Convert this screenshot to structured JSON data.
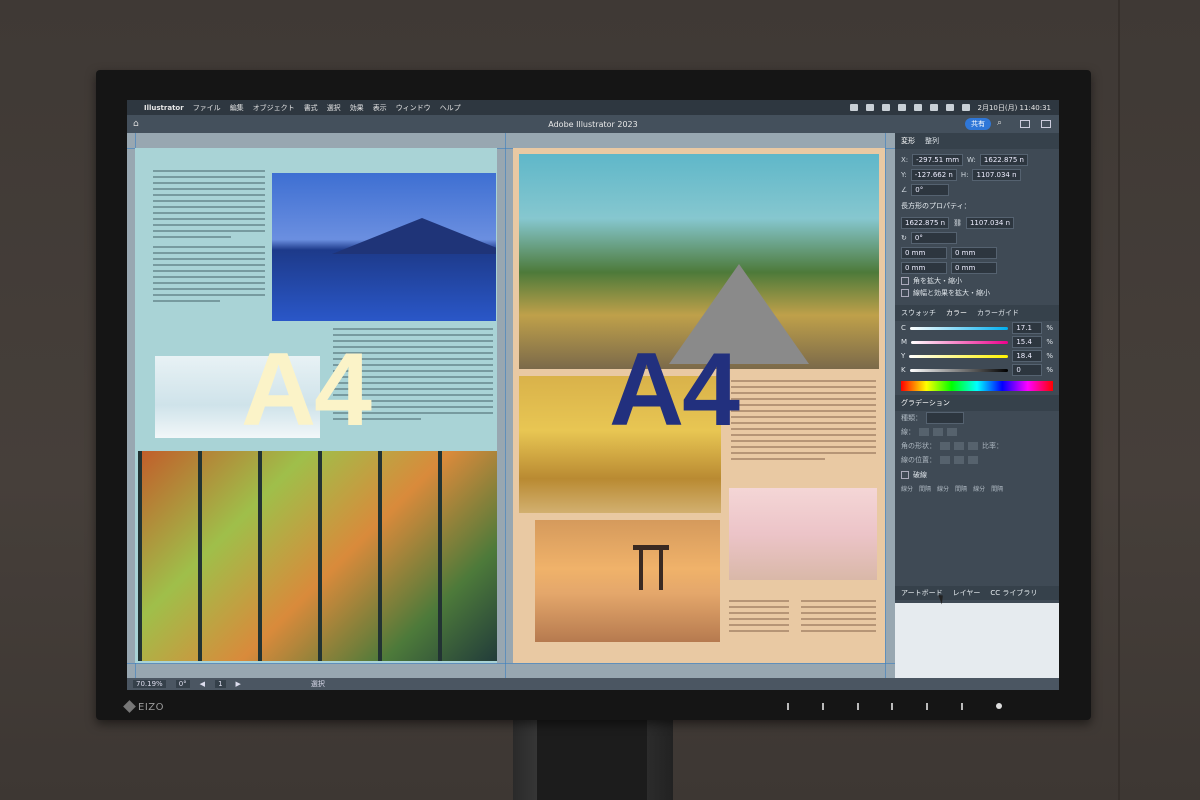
{
  "menubar": {
    "items": [
      "Illustrator",
      "ファイル",
      "編集",
      "オブジェクト",
      "書式",
      "選択",
      "効果",
      "表示",
      "ウィンドウ",
      "ヘルプ"
    ],
    "clock": "2月10日(月) 11:40:31"
  },
  "titlebar": {
    "title": "Adobe Illustrator 2023",
    "share_label": "共有"
  },
  "canvas": {
    "left_label": "A4",
    "right_label": "A4"
  },
  "panel": {
    "tabs": [
      "変形",
      "整列"
    ],
    "x_label": "X:",
    "x_value": "-297.51 mm",
    "y_label": "Y:",
    "y_value": "-127.662 n",
    "w_label": "W:",
    "w_value": "1622.875 n",
    "h_label": "H:",
    "h_value": "1107.034 n",
    "angle_value": "0°",
    "rect_props_title": "長方形のプロパティ：",
    "rect_w": "1622.875 n",
    "rect_h": "1107.034 n",
    "rect_angle": "0°",
    "corner_1": "0 mm",
    "corner_2": "0 mm",
    "corner_3": "0 mm",
    "corner_4": "0 mm",
    "check_1": "角を拡大・縮小",
    "check_2": "線幅と効果を拡大・縮小",
    "color_tabs": [
      "スウォッチ",
      "カラー",
      "カラーガイド"
    ],
    "c_label": "C",
    "c_value": "17.1",
    "m_label": "M",
    "m_value": "15.4",
    "y2_label": "Y",
    "y2_value": "18.4",
    "k_label": "K",
    "k_value": "0",
    "percent": "%",
    "gradient_title": "グラデーション",
    "grad_rows": [
      "種類：",
      "線：",
      "角の形状：",
      "線の位置："
    ],
    "ratio_label": "比率：",
    "dashed_label": "破線",
    "dash_labels": [
      "線分",
      "間隔",
      "線分",
      "間隔",
      "線分",
      "間隔"
    ],
    "bottom_tabs": [
      "アートボード",
      "レイヤー",
      "CC ライブラリ"
    ]
  },
  "status": {
    "zoom": "70.19%",
    "rotate": "0°",
    "artboard": "1",
    "mode": "選択"
  },
  "bezel": {
    "brand": "EIZO"
  }
}
